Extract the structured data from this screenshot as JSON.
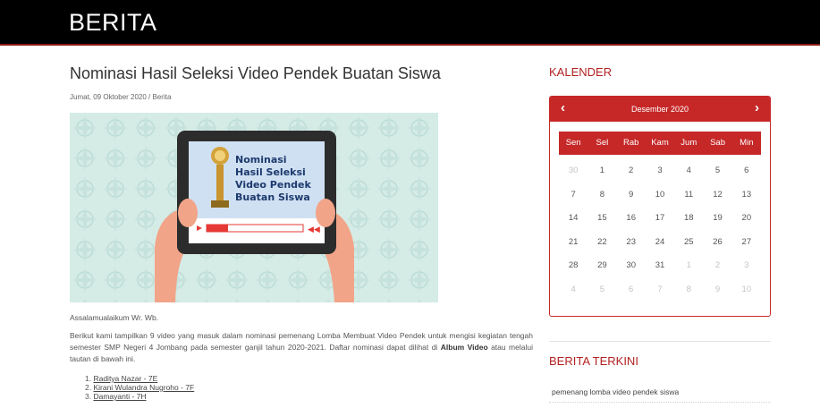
{
  "header": {
    "title": "BERITA"
  },
  "article": {
    "title": "Nominasi Hasil Seleksi Video Pendek Buatan Siswa",
    "meta": "Jumat, 09 Oktober 2020 / Berita",
    "hero": {
      "line1": "Nominasi",
      "line2": "Hasil Seleksi",
      "line3": "Video Pendek",
      "line4": "Buatan Siswa"
    },
    "greeting": "Assalamualaikum Wr. Wb.",
    "para_part1": "Berikut kami tampilkan 9 video yang masuk dalam nominasi pemenang Lomba Membuat Video Pendek untuk mengisi kegiatan tengah semester SMP Negeri 4 Jombang pada semester ganjil tahun 2020-2021. Daftar nominasi dapat dilihat di ",
    "para_bold": "Album Video",
    "para_part2": " atau melalui tautan di bawah ini.",
    "nominees": [
      {
        "num": "1.",
        "name": "Raditya Nazar - 7E"
      },
      {
        "num": "2.",
        "name": "Kirani Wulandra Nugroho - 7F"
      },
      {
        "num": "3.",
        "name": "Damayanti - 7H"
      }
    ]
  },
  "sidebar": {
    "calendar_title": "KALENDER",
    "calendar": {
      "month": "Desember 2020",
      "prev": "‹",
      "next": "›",
      "days": [
        "Sen",
        "Sel",
        "Rab",
        "Kam",
        "Jum",
        "Sab",
        "Min"
      ],
      "weeks": [
        [
          {
            "d": "30",
            "dim": true
          },
          {
            "d": "1"
          },
          {
            "d": "2"
          },
          {
            "d": "3"
          },
          {
            "d": "4"
          },
          {
            "d": "5"
          },
          {
            "d": "6"
          }
        ],
        [
          {
            "d": "7"
          },
          {
            "d": "8"
          },
          {
            "d": "9"
          },
          {
            "d": "10"
          },
          {
            "d": "11"
          },
          {
            "d": "12"
          },
          {
            "d": "13"
          }
        ],
        [
          {
            "d": "14"
          },
          {
            "d": "15"
          },
          {
            "d": "16"
          },
          {
            "d": "17"
          },
          {
            "d": "18"
          },
          {
            "d": "19"
          },
          {
            "d": "20"
          }
        ],
        [
          {
            "d": "21"
          },
          {
            "d": "22"
          },
          {
            "d": "23"
          },
          {
            "d": "24"
          },
          {
            "d": "25"
          },
          {
            "d": "26"
          },
          {
            "d": "27"
          }
        ],
        [
          {
            "d": "28"
          },
          {
            "d": "29"
          },
          {
            "d": "30"
          },
          {
            "d": "31"
          },
          {
            "d": "1",
            "dim": true
          },
          {
            "d": "2",
            "dim": true
          },
          {
            "d": "3",
            "dim": true
          }
        ],
        [
          {
            "d": "4",
            "dim": true
          },
          {
            "d": "5",
            "dim": true
          },
          {
            "d": "6",
            "dim": true
          },
          {
            "d": "7",
            "dim": true
          },
          {
            "d": "8",
            "dim": true
          },
          {
            "d": "9",
            "dim": true
          },
          {
            "d": "10",
            "dim": true
          }
        ]
      ]
    },
    "news_title": "BERITA TERKINI",
    "news_items": [
      "pemenang lomba video pendek siswa"
    ]
  },
  "colors": {
    "accent": "#c62828",
    "header_bg": "#000000"
  }
}
